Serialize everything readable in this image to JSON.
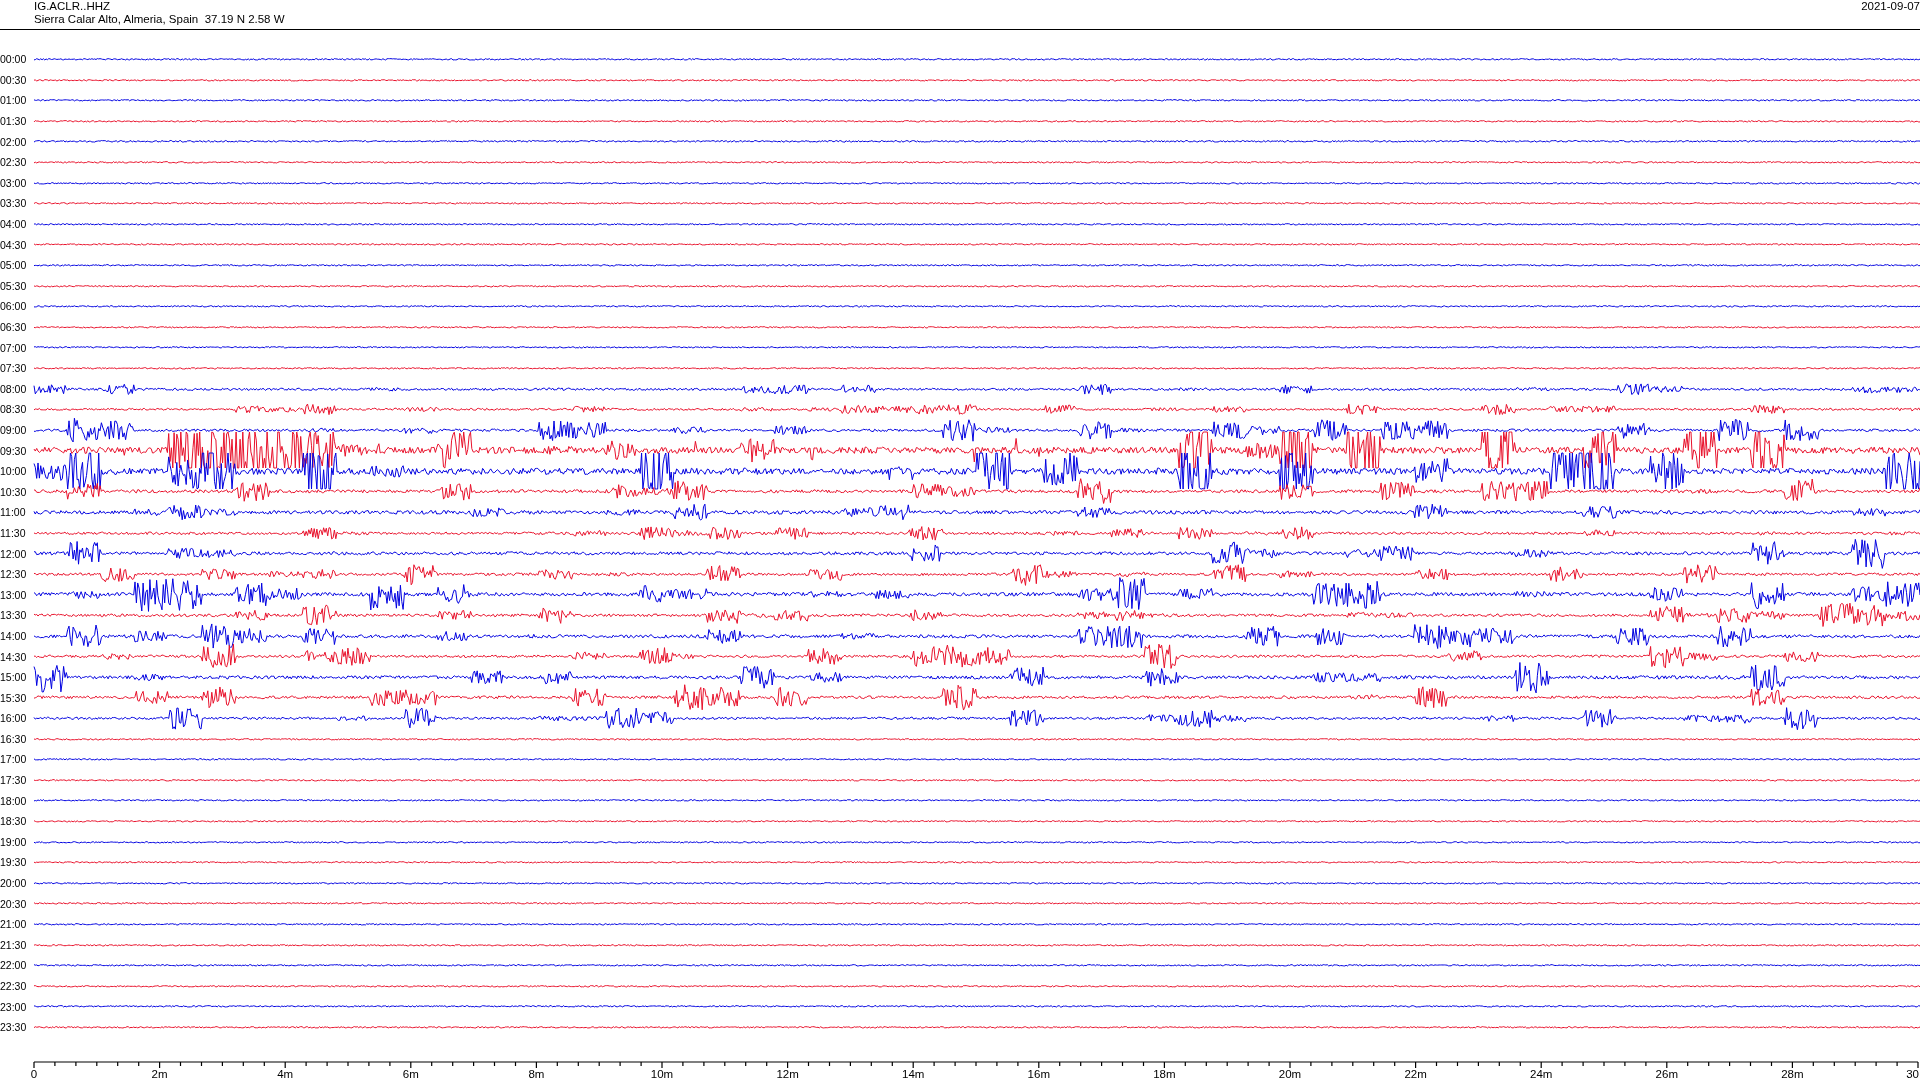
{
  "header": {
    "station_code": "IG.ACLR..HHZ",
    "location": "Sierra Calar Alto, Almeria, Spain  37.19 N 2.58 W",
    "date": "2021-09-07"
  },
  "traces": [
    {
      "time": "00:00",
      "color": "#0000e0"
    },
    {
      "time": "00:30",
      "color": "#e8102a"
    },
    {
      "time": "01:00",
      "color": "#0000e0"
    },
    {
      "time": "01:30",
      "color": "#e8102a"
    },
    {
      "time": "02:00",
      "color": "#0000e0"
    },
    {
      "time": "02:30",
      "color": "#e8102a"
    },
    {
      "time": "03:00",
      "color": "#0000e0"
    },
    {
      "time": "03:30",
      "color": "#e8102a"
    },
    {
      "time": "04:00",
      "color": "#0000e0"
    },
    {
      "time": "04:30",
      "color": "#e8102a"
    },
    {
      "time": "05:00",
      "color": "#0000e0"
    },
    {
      "time": "05:30",
      "color": "#e8102a"
    },
    {
      "time": "06:00",
      "color": "#0000e0"
    },
    {
      "time": "06:30",
      "color": "#e8102a"
    },
    {
      "time": "07:00",
      "color": "#0000e0"
    },
    {
      "time": "07:30",
      "color": "#e8102a"
    },
    {
      "time": "08:00",
      "color": "#0000e0"
    },
    {
      "time": "08:30",
      "color": "#e8102a"
    },
    {
      "time": "09:00",
      "color": "#0000e0"
    },
    {
      "time": "09:30",
      "color": "#e8102a"
    },
    {
      "time": "10:00",
      "color": "#0000e0"
    },
    {
      "time": "10:30",
      "color": "#e8102a"
    },
    {
      "time": "11:00",
      "color": "#0000e0"
    },
    {
      "time": "11:30",
      "color": "#e8102a"
    },
    {
      "time": "12:00",
      "color": "#0000e0"
    },
    {
      "time": "12:30",
      "color": "#e8102a"
    },
    {
      "time": "13:00",
      "color": "#0000e0"
    },
    {
      "time": "13:30",
      "color": "#e8102a"
    },
    {
      "time": "14:00",
      "color": "#0000e0"
    },
    {
      "time": "14:30",
      "color": "#e8102a"
    },
    {
      "time": "15:00",
      "color": "#0000e0"
    },
    {
      "time": "15:30",
      "color": "#e8102a"
    },
    {
      "time": "16:00",
      "color": "#0000e0"
    },
    {
      "time": "16:30",
      "color": "#e8102a"
    },
    {
      "time": "17:00",
      "color": "#0000e0"
    },
    {
      "time": "17:30",
      "color": "#e8102a"
    },
    {
      "time": "18:00",
      "color": "#0000e0"
    },
    {
      "time": "18:30",
      "color": "#e8102a"
    },
    {
      "time": "19:00",
      "color": "#0000e0"
    },
    {
      "time": "19:30",
      "color": "#e8102a"
    },
    {
      "time": "20:00",
      "color": "#0000e0"
    },
    {
      "time": "20:30",
      "color": "#e8102a"
    },
    {
      "time": "21:00",
      "color": "#0000e0"
    },
    {
      "time": "21:30",
      "color": "#e8102a"
    },
    {
      "time": "22:00",
      "color": "#0000e0"
    },
    {
      "time": "22:30",
      "color": "#e8102a"
    },
    {
      "time": "23:00",
      "color": "#0000e0"
    },
    {
      "time": "23:30",
      "color": "#e8102a"
    }
  ],
  "time_axis": {
    "labels": [
      "0",
      "2m",
      "4m",
      "6m",
      "8m",
      "10m",
      "12m",
      "14m",
      "16m",
      "18m",
      "20m",
      "22m",
      "24m",
      "26m",
      "28m",
      "30"
    ]
  }
}
